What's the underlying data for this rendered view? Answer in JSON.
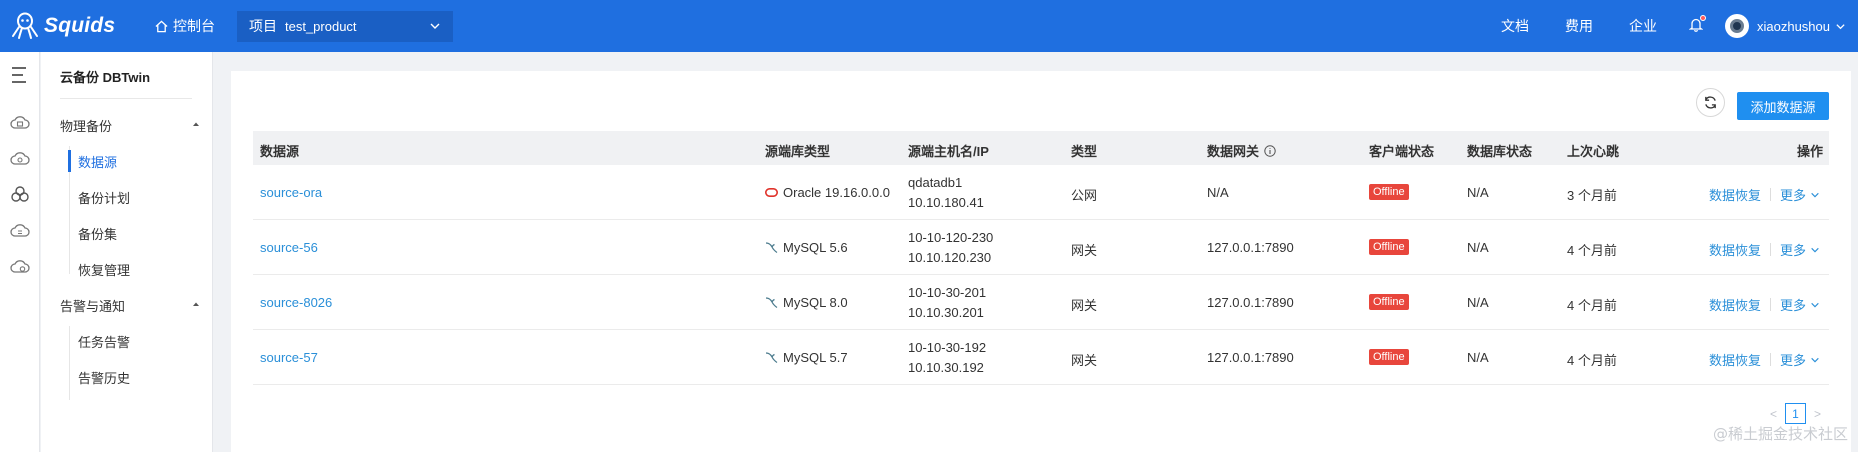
{
  "header": {
    "brand": "Squids",
    "console_label": "控制台",
    "project_label": "项目",
    "project_value": "test_product",
    "links": [
      "文档",
      "费用",
      "企业"
    ],
    "username": "xiaozhushou"
  },
  "sidebar": {
    "title": "云备份 DBTwin",
    "groups": [
      {
        "label": "物理备份",
        "items": [
          "数据源",
          "备份计划",
          "备份集",
          "恢复管理"
        ]
      },
      {
        "label": "告警与通知",
        "items": [
          "任务告警",
          "告警历史"
        ]
      }
    ],
    "active_item": "数据源"
  },
  "toolbar": {
    "add_label": "添加数据源"
  },
  "table": {
    "columns": [
      "数据源",
      "源端库类型",
      "源端主机名/IP",
      "类型",
      "数据网关",
      "客户端状态",
      "数据库状态",
      "上次心跳",
      "操作"
    ],
    "rows": [
      {
        "name": "source-ora",
        "db_type": "Oracle 19.16.0.0.0",
        "db_icon": "oracle-icon",
        "host": "qdatadb1",
        "ip": "10.10.180.41",
        "kind": "公网",
        "gateway": "N/A",
        "client_status": "Offline",
        "db_status": "N/A",
        "heartbeat": "3 个月前",
        "action": "数据恢复",
        "more": "更多"
      },
      {
        "name": "source-56",
        "db_type": "MySQL 5.6",
        "db_icon": "mysql-icon",
        "host": "10-10-120-230",
        "ip": "10.10.120.230",
        "kind": "网关",
        "gateway": "127.0.0.1:7890",
        "client_status": "Offline",
        "db_status": "N/A",
        "heartbeat": "4 个月前",
        "action": "数据恢复",
        "more": "更多"
      },
      {
        "name": "source-8026",
        "db_type": "MySQL 8.0",
        "db_icon": "mysql-icon",
        "host": "10-10-30-201",
        "ip": "10.10.30.201",
        "kind": "网关",
        "gateway": "127.0.0.1:7890",
        "client_status": "Offline",
        "db_status": "N/A",
        "heartbeat": "4 个月前",
        "action": "数据恢复",
        "more": "更多"
      },
      {
        "name": "source-57",
        "db_type": "MySQL 5.7",
        "db_icon": "mysql-icon",
        "host": "10-10-30-192",
        "ip": "10.10.30.192",
        "kind": "网关",
        "gateway": "127.0.0.1:7890",
        "client_status": "Offline",
        "db_status": "N/A",
        "heartbeat": "4 个月前",
        "action": "数据恢复",
        "more": "更多"
      }
    ]
  },
  "pagination": {
    "current": "1",
    "prev": "<",
    "next": ">"
  },
  "watermark": "@稀土掘金技术社区",
  "colors": {
    "primary": "#1f6fe0",
    "button": "#1f8ff0",
    "offline": "#e8463c",
    "link": "#2a8fd8",
    "oracle": "#e0332b"
  }
}
